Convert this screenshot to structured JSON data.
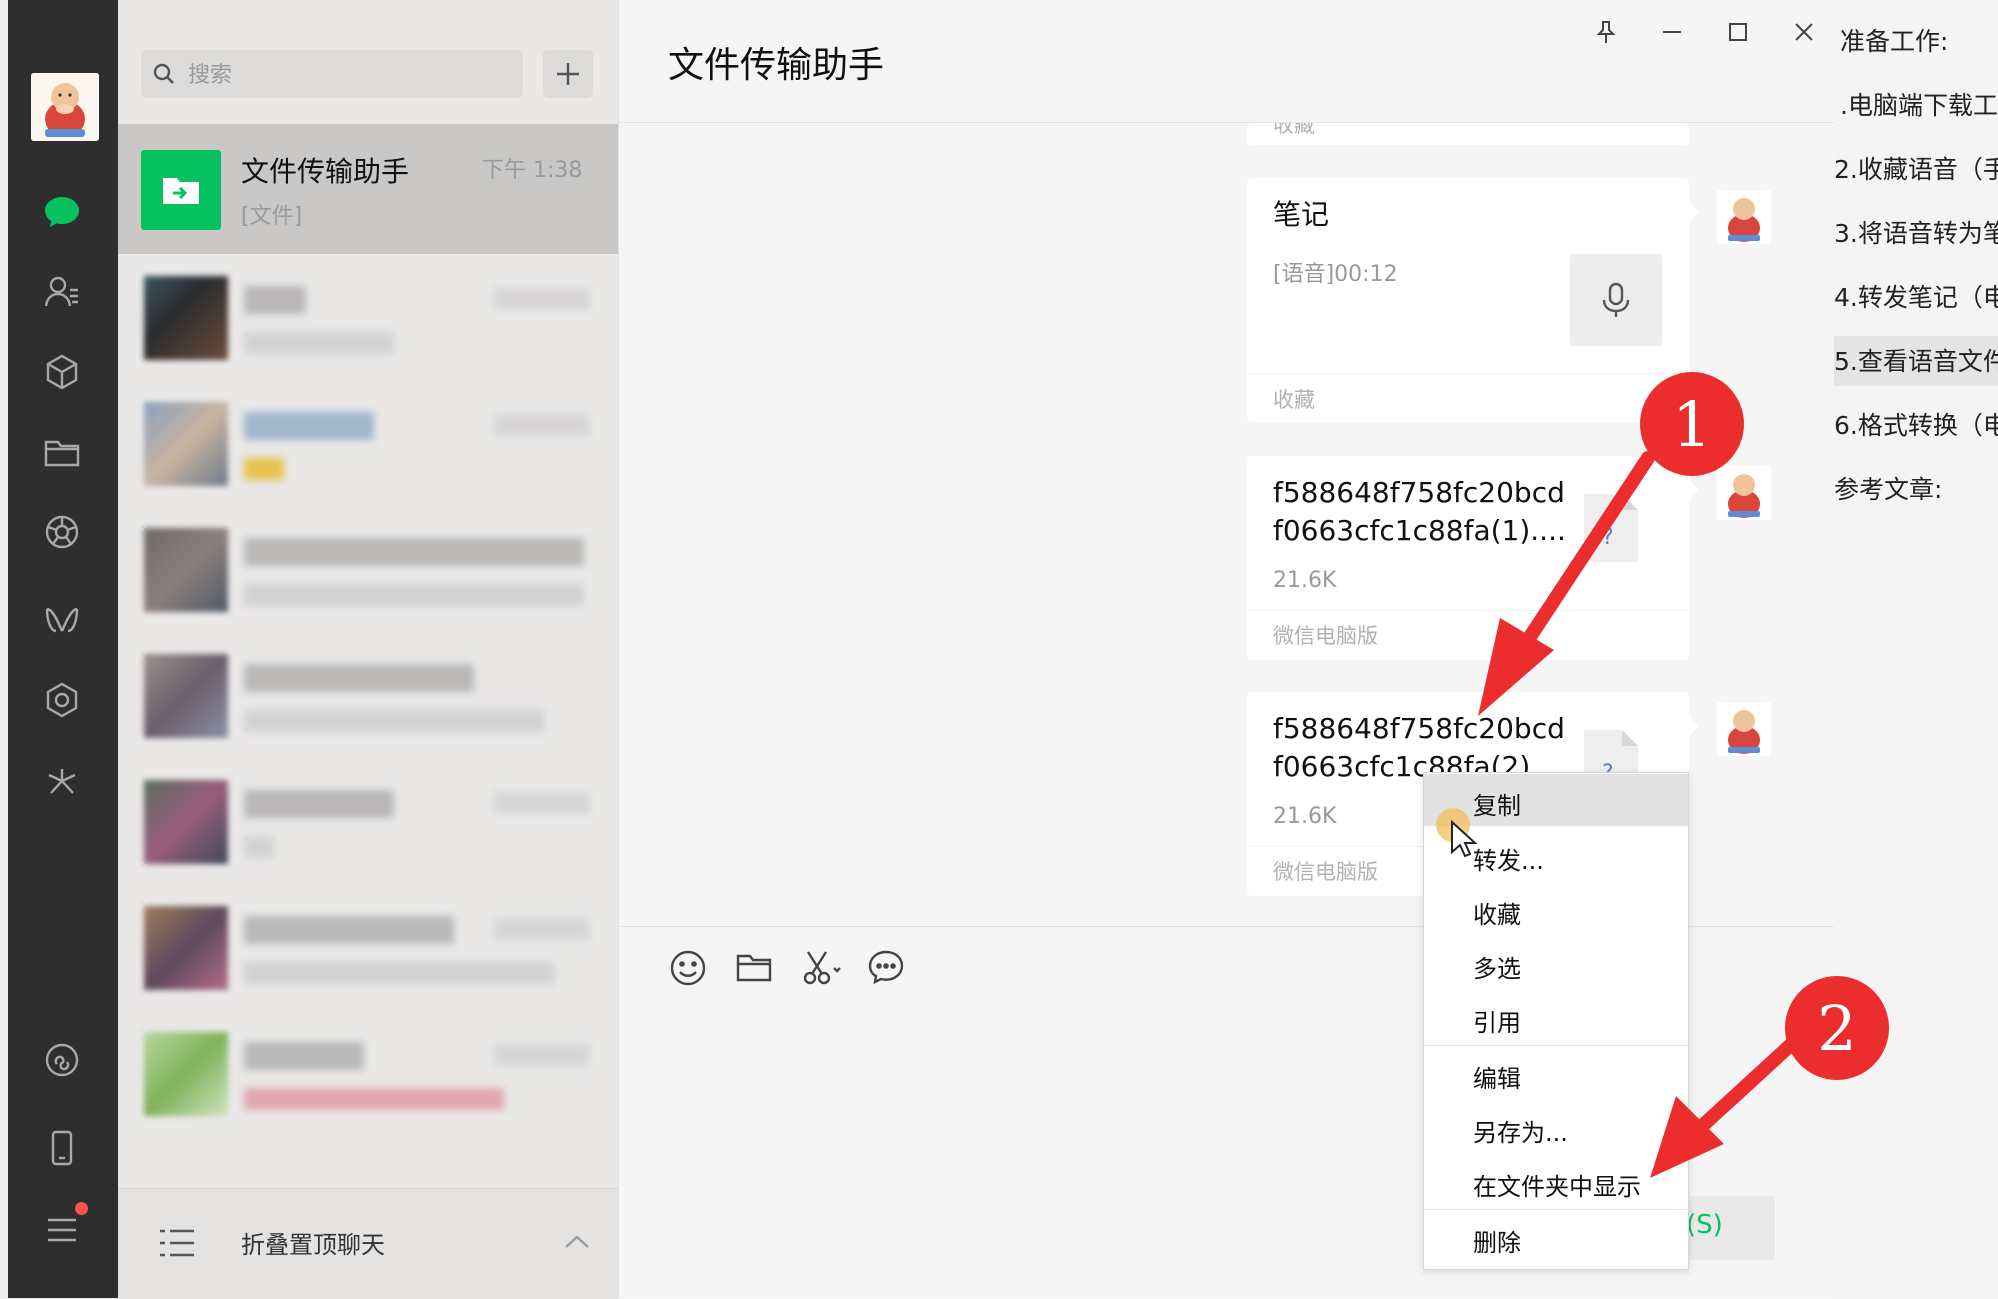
{
  "search": {
    "placeholder": "搜索"
  },
  "active_chat": {
    "name": "文件传输助手",
    "time": "下午 1:38",
    "preview": "[文件]"
  },
  "fold_bar": {
    "label": "折叠置顶聊天"
  },
  "chat": {
    "title": "文件传输助手",
    "cut_off_top_label": "收藏",
    "messages": [
      {
        "type": "note",
        "title": "笔记",
        "subtitle": "[语音]00:12",
        "footer": "收藏"
      },
      {
        "type": "file",
        "filename_line1": "f588648f758fc20bcd",
        "filename_line2": "f0663cfc1c88fa(1)....",
        "size": "21.6K",
        "footer": "微信电脑版"
      },
      {
        "type": "file",
        "filename_line1": "f588648f758fc20bcd",
        "filename_line2": "f0663cfc1c88fa(2)...",
        "size": "21.6K",
        "footer": "微信电脑版"
      }
    ],
    "send_label": "(S)"
  },
  "context_menu": {
    "items": [
      "复制",
      "转发...",
      "收藏",
      "多选",
      "引用",
      "编辑",
      "另存为...",
      "在文件夹中显示",
      "删除"
    ]
  },
  "doc_panel": {
    "lines": [
      "准备工作:",
      ".电脑端下载工",
      "2.收藏语音（手",
      "3.将语音转为笔",
      "4.转发笔记（电",
      "5.查看语音文件",
      "6.格式转换（电",
      "参考文章:"
    ]
  },
  "annotations": [
    "1",
    "2"
  ],
  "colors": {
    "accent": "#07c160",
    "nav_bg": "#2e2e2e",
    "annotation_red": "#ec2d2d"
  }
}
